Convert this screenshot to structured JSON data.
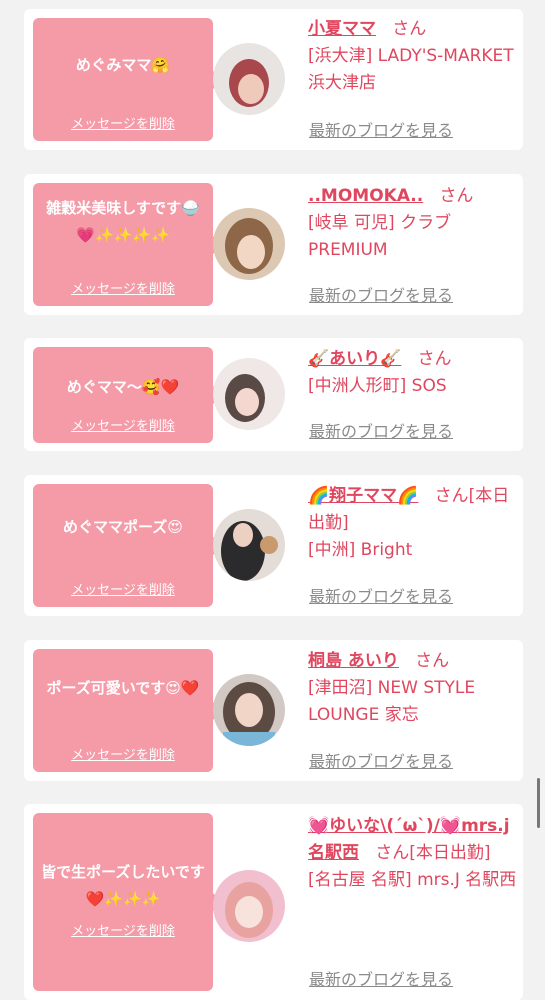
{
  "delete_label": "メッセージを削除",
  "blog_label": "最新のブログを見る",
  "san": "さん",
  "cards": [
    {
      "message": "めぐみママ🤗",
      "name": "小夏ママ",
      "suffix": "",
      "shop": "[浜大津] LADY'S-MARKET 浜大津店"
    },
    {
      "message": "雑穀米美味しすです🍚💗✨✨✨✨",
      "name": "..MOMOKA..",
      "suffix": "",
      "shop": "[岐阜 可児] クラブ PREMIUM"
    },
    {
      "message": "めぐママ〜🥰❤️",
      "name": "🎸あいり🎸",
      "suffix": "",
      "shop": "[中洲人形町] SOS"
    },
    {
      "message": "めぐママポーズ😍",
      "name": "🌈翔子ママ🌈",
      "suffix": "[本日出勤]",
      "shop": "[中洲] Bright"
    },
    {
      "message": "ポーズ可愛いです😍❤️",
      "name": "桐島 あいり",
      "suffix": "",
      "shop": "[津田沼] NEW STYLE LOUNGE 家忘"
    },
    {
      "message": "皆で生ポーズしたいです❤️✨✨✨",
      "name": "💓ゆいな\\(´ω`)/💓mrs.j名駅西",
      "suffix": "[本日出勤]",
      "shop": "[名古屋 名駅] mrs.J 名駅西"
    }
  ],
  "colors": {
    "bubble": "#f59aa7",
    "name": "#e0475f",
    "blog": "#8a8a8a",
    "background": "#f2f2f2"
  }
}
